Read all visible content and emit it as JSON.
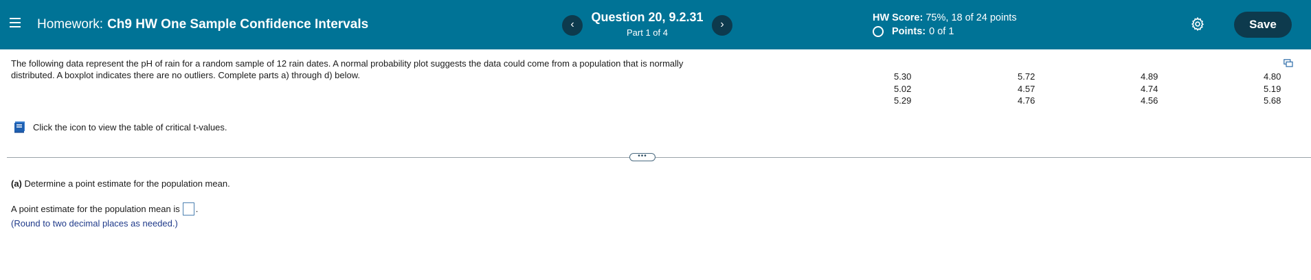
{
  "header": {
    "menu_icon": "hamburger-menu-icon",
    "hw_prefix": "Homework:",
    "hw_name": "Ch9 HW One Sample Confidence Intervals",
    "question_title": "Question 20, 9.2.31",
    "question_part": "Part 1 of 4",
    "prev_label": "‹",
    "next_label": "›",
    "score_label": "HW Score:",
    "score_value": "75%, 18 of 24 points",
    "points_label": "Points:",
    "points_value": "0 of 1",
    "save_label": "Save",
    "colors": {
      "bar": "#007396",
      "button": "#0d3a4d"
    }
  },
  "problem": {
    "line1": "The following data represent the pH of rain for a random sample of 12 rain dates. A normal probability plot suggests the data could come from a population that is normally",
    "line2": "distributed. A boxplot indicates there are no outliers. Complete parts a) through d) below.",
    "data_columns": [
      [
        "5.30",
        "5.02",
        "5.29"
      ],
      [
        "5.72",
        "4.57",
        "4.76"
      ],
      [
        "4.89",
        "4.74",
        "4.56"
      ],
      [
        "4.80",
        "5.19",
        "5.68"
      ]
    ],
    "tvalues_text": "Click the icon to view the table of critical t-values."
  },
  "expander_label": "•••",
  "part_a": {
    "label": "(a)",
    "question": "Determine a point estimate for the population mean.",
    "answer_prompt": "A point estimate for the population mean is",
    "answer_value": "",
    "suffix": ".",
    "round_note": "(Round to two decimal places as needed.)"
  }
}
